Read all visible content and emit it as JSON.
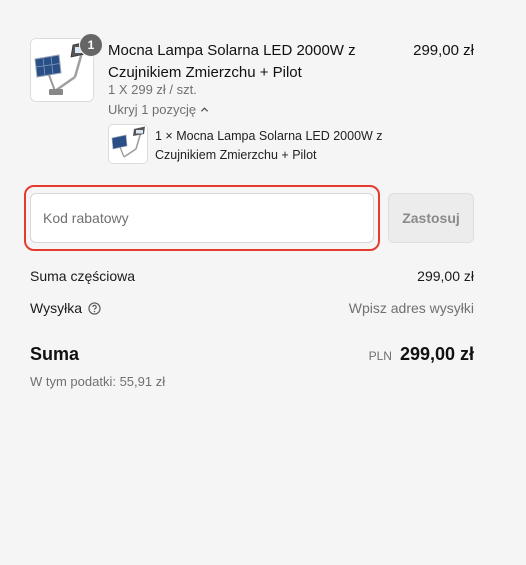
{
  "product": {
    "title": "Mocna Lampa Solarna LED 2000W z Czujnikiem Zmierzchu + Pilot",
    "price": "299,00 zł",
    "quantity_badge": "1",
    "unit_price": "1 X 299 zł / szt.",
    "toggle_label": "Ukryj 1 pozycję",
    "sub_item": "1 × Mocna Lampa Solarna LED 2000W z Czujnikiem Zmierzchu + Pilot"
  },
  "discount": {
    "placeholder": "Kod rabatowy",
    "value": "",
    "apply_label": "Zastosuj",
    "highlight_color": "#e53b2f"
  },
  "summary": {
    "subtotal_label": "Suma częściowa",
    "subtotal_value": "299,00 zł",
    "shipping_label": "Wysyłka",
    "shipping_value": "Wpisz adres wysyłki",
    "total_label": "Suma",
    "currency": "PLN",
    "total_value": "299,00 zł",
    "tax_note": "W tym podatki: 55,91 zł"
  }
}
